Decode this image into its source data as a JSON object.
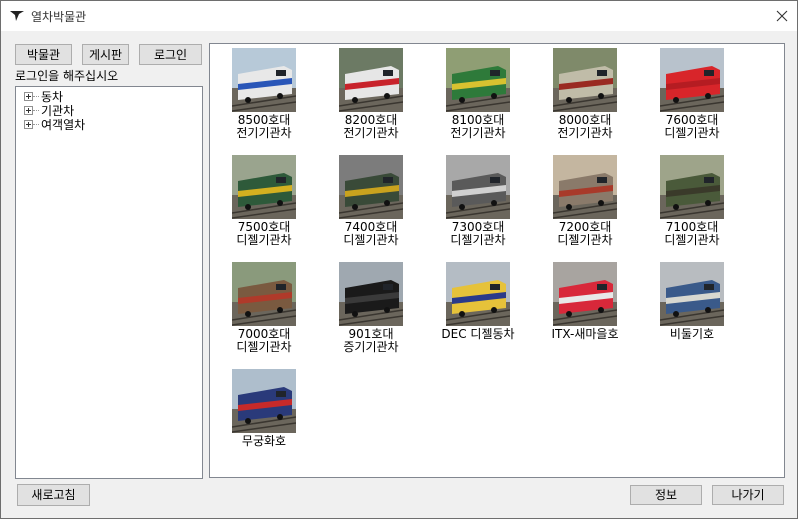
{
  "window": {
    "title": "열차박물관"
  },
  "toolbar": {
    "museum_label": "박물관",
    "board_label": "게시판",
    "login_label": "로그인"
  },
  "login_prompt": "로그인을 해주십시오",
  "tree": [
    {
      "label": "동차"
    },
    {
      "label": "기관차"
    },
    {
      "label": "여객열차"
    }
  ],
  "gallery": [
    {
      "line1": "8500호대",
      "line2": "전기기관차",
      "icon": "train-8500-thumbnail",
      "colors": [
        "#b7c9d8",
        "#e8e8e8",
        "#2a56b8"
      ]
    },
    {
      "line1": "8200호대",
      "line2": "전기기관차",
      "icon": "train-8200-thumbnail",
      "colors": [
        "#6c7a64",
        "#e6e6e6",
        "#c8232b"
      ]
    },
    {
      "line1": "8100호대",
      "line2": "전기기관차",
      "icon": "train-8100-thumbnail",
      "colors": [
        "#8f9e74",
        "#2e7a3a",
        "#d8c230"
      ]
    },
    {
      "line1": "8000호대",
      "line2": "전기기관차",
      "icon": "train-8000-thumbnail",
      "colors": [
        "#7f8a6a",
        "#c0bca8",
        "#9a2a22"
      ]
    },
    {
      "line1": "7600호대",
      "line2": "디젤기관차",
      "icon": "train-7600-thumbnail",
      "colors": [
        "#b8c2cc",
        "#d8252a",
        "#b51c22"
      ]
    },
    {
      "line1": "7500호대",
      "line2": "디젤기관차",
      "icon": "train-7500-thumbnail",
      "colors": [
        "#9aa48e",
        "#2e5a3a",
        "#d4b020"
      ]
    },
    {
      "line1": "7400호대",
      "line2": "디젤기관차",
      "icon": "train-7400-thumbnail",
      "colors": [
        "#7c7c7c",
        "#394a38",
        "#c9a21e"
      ]
    },
    {
      "line1": "7300호대",
      "line2": "디젤기관차",
      "icon": "train-7300-thumbnail",
      "colors": [
        "#a8a8a8",
        "#5a5a5a",
        "#d0d0d0"
      ]
    },
    {
      "line1": "7200호대",
      "line2": "디젤기관차",
      "icon": "train-7200-thumbnail",
      "colors": [
        "#c4b6a0",
        "#8a7a6a",
        "#a83a2a"
      ]
    },
    {
      "line1": "7100호대",
      "line2": "디젤기관차",
      "icon": "train-7100-thumbnail",
      "colors": [
        "#9ea48a",
        "#4a5a3a",
        "#3a3a2a"
      ]
    },
    {
      "line1": "7000호대",
      "line2": "디젤기관차",
      "icon": "train-7000-thumbnail",
      "colors": [
        "#8a9a7c",
        "#7a5a40",
        "#b03a2a"
      ]
    },
    {
      "line1": "901호대",
      "line2": "증기기관차",
      "icon": "steam-locomotive-thumbnail",
      "colors": [
        "#9fa8b0",
        "#1a1a1a",
        "#3a3a3a"
      ]
    },
    {
      "line1": "DEC 디젤동차",
      "line2": "",
      "icon": "dec-railcar-thumbnail",
      "colors": [
        "#b4bcc4",
        "#e6c23a",
        "#2a3a8a"
      ]
    },
    {
      "line1": "ITX-새마을호",
      "line2": "",
      "icon": "itx-saemaeul-thumbnail",
      "colors": [
        "#a8a4a0",
        "#d8283a",
        "#e8e8e8"
      ]
    },
    {
      "line1": "비둘기호",
      "line2": "",
      "icon": "bidulgi-thumbnail",
      "colors": [
        "#b8bcc0",
        "#3a5a8a",
        "#d8d8d0"
      ]
    },
    {
      "line1": "무궁화호",
      "line2": "",
      "icon": "mugunghwa-thumbnail",
      "colors": [
        "#aebecc",
        "#2a3a7a",
        "#c82a2a"
      ]
    }
  ],
  "footer": {
    "refresh_label": "새로고침",
    "info_label": "정보",
    "exit_label": "나가기"
  }
}
